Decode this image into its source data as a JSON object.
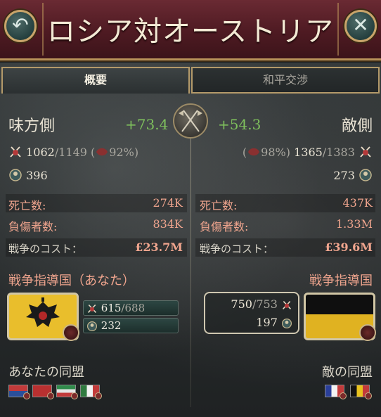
{
  "header": {
    "title": "ロシア対オーストリア"
  },
  "tabs": {
    "overview": "概要",
    "peace": "和平交渉"
  },
  "our_side": {
    "title": "味方側",
    "score": "+73.4",
    "troops_current": "1062",
    "troops_max": "/1149",
    "troops_morale": "(",
    "troops_morale_pct": "92%)",
    "generals": "396",
    "dead_label": "死亡数:",
    "dead_value": "274K",
    "wounded_label": "負傷者数:",
    "wounded_value": "834K",
    "cost_label": "戦争のコスト：",
    "cost_value": "£23.7M",
    "leader_label": "戦争指導国（あなた）",
    "leader_troops": "615",
    "leader_troops_max": "/688",
    "leader_generals": "232",
    "alliance_label": "あなたの同盟"
  },
  "enemy_side": {
    "title": "敵側",
    "score": "+54.3",
    "troops_morale": "(",
    "troops_morale_pct": "98%)",
    "troops_current": "1365",
    "troops_max": "/1383",
    "generals": "273",
    "dead_label": "死亡数:",
    "dead_value": "437K",
    "wounded_label": "負傷者数:",
    "wounded_value": "1.33M",
    "cost_label": "戦争のコスト：",
    "cost_value": "£39.6M",
    "leader_label": "戦争指導国",
    "leader_troops": "750",
    "leader_troops_max": "/753",
    "leader_generals": "197",
    "alliance_label": "敵の同盟"
  },
  "colors": {
    "banner": "#5a1f28",
    "gold": "#c8a46a",
    "positive": "#7fc15d",
    "loss": "#f0a58e"
  },
  "icons": {
    "back": "back-arrow-icon",
    "close": "close-icon",
    "soldiers": "crossed-swords-icon",
    "generals": "general-badge-icon",
    "emblem": "crossed-flags-emblem-icon"
  }
}
